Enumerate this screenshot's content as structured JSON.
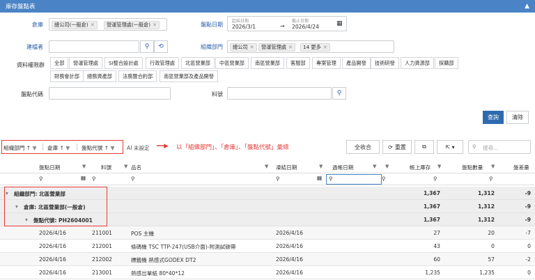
{
  "title": "庫存盤點表",
  "form": {
    "warehouse_label": "倉庫",
    "warehouse_tags": [
      "總公司(一般倉)",
      "營運管理處(一般倉)"
    ],
    "count_date_label": "盤點日期",
    "start_caption": "起始日期",
    "start_date": "2026/3/1",
    "end_caption": "截止日期",
    "end_date": "2026/4/24",
    "creator_label": "建檔者",
    "org_label": "組織部門",
    "org_tags": [
      "總公司",
      "營運管理處",
      "14 更多"
    ],
    "perm_label": "資料權限群",
    "perm_row1": [
      "全部",
      "營運管理處",
      "SI整合設計處",
      "行政管理處",
      "北區營業部",
      "中區營業部",
      "南區營業部",
      "客服部",
      "專案管理",
      "產品開發",
      "技術研發",
      "人力資源部",
      "採購部"
    ],
    "perm_row2": [
      "財務會計部",
      "總務資產部",
      "法務暨合約部",
      "南區營業部及產品開發"
    ],
    "count_code_label": "盤點代碼",
    "item_no_label": "料號",
    "query_button": "查詢",
    "clear_button": "清除"
  },
  "toolbar": {
    "group_chips": [
      "組織部門 ↑",
      "倉庫 ↑",
      "盤點代號 ↑"
    ],
    "ai_unset": "AI 未設定",
    "annotation": "以「組織部門」、「倉庫」、「盤點代號」彙總",
    "collapse_all": "全收合",
    "reset": "重置",
    "search_placeholder": "搜尋..."
  },
  "columns": [
    "盤點日期",
    "料號",
    "品名",
    "凍結日期",
    "過帳日期",
    "帳上庫存",
    "盤點數量",
    "盤差量"
  ],
  "group_rows": [
    {
      "label": "組織部門: 北區營業部",
      "stock": "1,367",
      "count": "1,312",
      "diff": "-9"
    },
    {
      "label": "倉庫: 北區營業部(一般倉)",
      "stock": "1,367",
      "count": "1,312",
      "diff": "-9"
    },
    {
      "label": "盤點代號: PH2604001",
      "stock": "1,367",
      "count": "1,312",
      "diff": "-9"
    }
  ],
  "data_rows": [
    {
      "date": "2026/4/16",
      "item": "211001",
      "name": "POS 主機",
      "freeze": "2026/4/16",
      "post": "",
      "stock": "27",
      "count": "20",
      "diff": "-7"
    },
    {
      "date": "2026/4/16",
      "item": "212001",
      "name": "條碼機 TSC TTP-247(USB介面)-附測試碳帶",
      "freeze": "2026/4/16",
      "post": "",
      "stock": "43",
      "count": "0",
      "diff": "0"
    },
    {
      "date": "2026/4/16",
      "item": "212002",
      "name": "標籤機 熱感式GODEX DT2",
      "freeze": "2026/4/16",
      "post": "",
      "stock": "60",
      "count": "57",
      "diff": "-2"
    },
    {
      "date": "2026/4/16",
      "item": "213001",
      "name": "熱感出單紙 80*40*12",
      "freeze": "2026/4/16",
      "post": "",
      "stock": "1,235",
      "count": "1,235",
      "diff": "0"
    }
  ]
}
